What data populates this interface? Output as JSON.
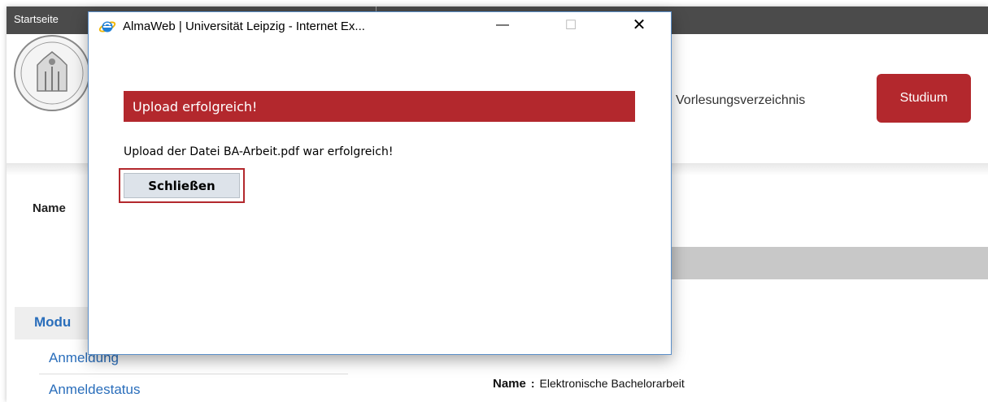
{
  "background_page": {
    "topbar": {
      "link": "Startseite"
    },
    "nav": {
      "link": "Vorlesungsverzeichnis",
      "active": "Studium"
    },
    "name_label": "Name",
    "sidebar": {
      "heading": "Modu",
      "items": [
        "Anmeldung",
        "Anmeldestatus"
      ]
    },
    "detail": {
      "label": "Name",
      "separator": ":",
      "value": "Elektronische Bachelorarbeit"
    }
  },
  "popup": {
    "title": "AlmaWeb | Universität Leipzig - Internet Ex...",
    "controls": {
      "minimize": "—",
      "maximize": "☐",
      "close": "✕"
    },
    "banner": "Upload erfolgreich!",
    "message": "Upload der Datei BA-Arbeit.pdf war erfolgreich!",
    "close_button": "Schließen"
  },
  "colors": {
    "accent_red": "#b3282d",
    "link_blue": "#2a6ebb",
    "topbar": "#4b4b4b",
    "window_border": "#5b8fc9"
  },
  "icons": [
    "internet-explorer-icon",
    "university-seal-icon"
  ]
}
